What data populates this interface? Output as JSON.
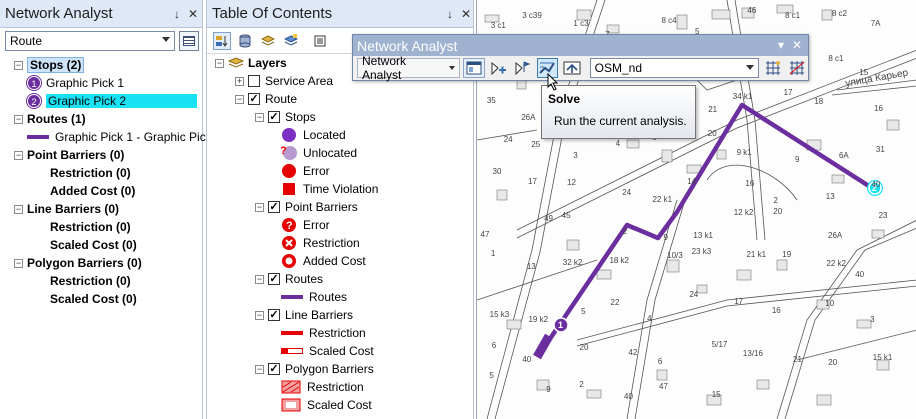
{
  "na_panel": {
    "title": "Network Analyst",
    "pin": "↓",
    "close": "✕",
    "combo_value": "Route",
    "tree": {
      "stops": {
        "label": "Stops (2)",
        "items": [
          {
            "num": "1",
            "label": "Graphic Pick 1"
          },
          {
            "num": "2",
            "label": "Graphic Pick 2"
          }
        ]
      },
      "routes": {
        "label": "Routes (1)",
        "items": [
          {
            "label": "Graphic Pick 1 - Graphic Pick"
          }
        ]
      },
      "point_barriers": {
        "label": "Point Barriers (0)",
        "items": [
          {
            "label": "Restriction (0)"
          },
          {
            "label": "Added Cost (0)"
          }
        ]
      },
      "line_barriers": {
        "label": "Line Barriers (0)",
        "items": [
          {
            "label": "Restriction (0)"
          },
          {
            "label": "Scaled Cost (0)"
          }
        ]
      },
      "polygon_barriers": {
        "label": "Polygon Barriers (0)",
        "items": [
          {
            "label": "Restriction (0)"
          },
          {
            "label": "Scaled Cost (0)"
          }
        ]
      }
    }
  },
  "toc_panel": {
    "title": "Table Of Contents",
    "pin": "↓",
    "close": "✕",
    "layers_label": "Layers",
    "service_area": "Service Area",
    "route": "Route",
    "stops_group": "Stops",
    "stops_items": [
      "Located",
      "Unlocated",
      "Error",
      "Time Violation"
    ],
    "point_barriers_group": "Point Barriers",
    "point_barriers_items": [
      "Error",
      "Restriction",
      "Added Cost"
    ],
    "routes_group": "Routes",
    "routes_items": [
      "Routes"
    ],
    "line_barriers_group": "Line Barriers",
    "line_barriers_items": [
      "Restriction",
      "Scaled Cost"
    ],
    "polygon_barriers_group": "Polygon Barriers",
    "polygon_barriers_items": [
      "Restriction",
      "Scaled Cost"
    ]
  },
  "na_toolbar": {
    "title": "Network Analyst",
    "menu_label": "Network Analyst",
    "network_dataset": "OSM_nd",
    "close": "✕",
    "dropdown": "▾"
  },
  "tooltip": {
    "title": "Solve",
    "description": "Run the current analysis."
  },
  "map": {
    "street_label": "улица Карьер",
    "labels": [
      "3 c1",
      "3 c39",
      "1 c3",
      "7",
      "8 c4",
      "5",
      "46",
      "8 c1",
      "8 c2",
      "7A",
      "8",
      "2",
      "9/11 c1",
      "8",
      "19 k2",
      "16 k1",
      "16 k2",
      "18 k1",
      "8 c1",
      "15",
      "35",
      "26A",
      "22",
      "30",
      "32",
      "21",
      "34 k1",
      "17",
      "18",
      "16",
      "24",
      "25",
      "3",
      "4",
      "5",
      "20",
      "9 k1",
      "9",
      "6A",
      "31",
      "30",
      "17",
      "12",
      "24",
      "22 k1",
      "14",
      "16",
      "2",
      "13",
      "40",
      "47",
      "49",
      "45",
      "2",
      "9",
      "13 k1",
      "12 k2",
      "20",
      "26A",
      "23",
      "1",
      "13",
      "32 k2",
      "18 k2",
      "10/3",
      "23 k3",
      "21 k1",
      "19",
      "22 k2",
      "40",
      "15 k3",
      "19 k2",
      "5",
      "22",
      "4",
      "24",
      "17",
      "16",
      "10",
      "3",
      "6",
      "40",
      "20",
      "42",
      "6",
      "5/17",
      "13/16",
      "21",
      "20",
      "15 k1",
      "5",
      "9",
      "2",
      "40",
      "47",
      "15"
    ],
    "stop_2_num": "2",
    "stop_1_num": "1"
  },
  "colors": {
    "route": "#6b2e9e",
    "stop_selected": "#19e2f5",
    "panel_title_bg": "#dfe8f6",
    "toolbar_title_bg": "#9fb2cf"
  }
}
